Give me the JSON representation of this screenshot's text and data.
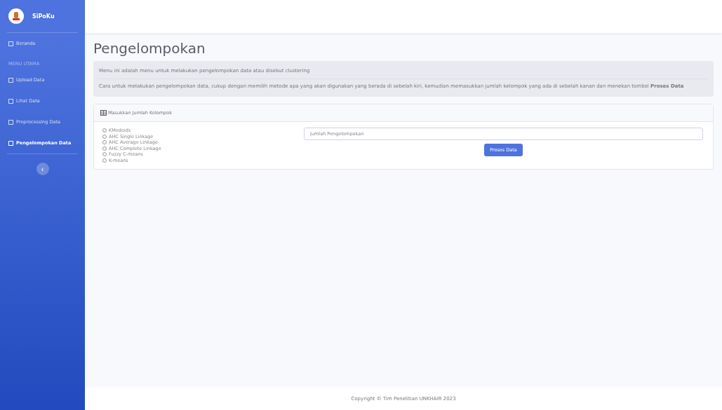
{
  "brand": {
    "name": "SiPoKu"
  },
  "sidebar": {
    "items": [
      {
        "label": "Beranda",
        "kind": "link",
        "selected": false
      },
      {
        "label": "MENU UTAMA",
        "kind": "heading"
      },
      {
        "label": "Upload Data",
        "kind": "link",
        "selected": false
      },
      {
        "label": "Lihat Data",
        "kind": "link",
        "selected": false
      },
      {
        "label": "Preprocessing Data",
        "kind": "link",
        "selected": false
      },
      {
        "label": "Pengelompokan Data",
        "kind": "link",
        "selected": true
      }
    ],
    "toggle": "‹"
  },
  "page": {
    "title": "Pengelompokan",
    "info": [
      "Menu ini adalah menu untuk melakukan pengelompokan data atau disebut clustering",
      "Cara untuk melakukan pengelompokan data, cukup dengan memilih metode apa yang akan digunakan yang berada di sebelah kiri, kemudian memasukkan jumlah kelompok yang ada di sebelah kanan dan menekan tombol **Proses Data**"
    ]
  },
  "card": {
    "header": "Masukkan Jumlah Kelompok",
    "methods": [
      {
        "label": "KMedoids",
        "selected": false
      },
      {
        "label": "AHC Single Linkage",
        "selected": false
      },
      {
        "label": "AHC Average Linkage",
        "selected": false
      },
      {
        "label": "AHC Complete Linkage",
        "selected": false
      },
      {
        "label": "Fuzzy C-means",
        "selected": false
      },
      {
        "label": "K-means",
        "selected": false
      }
    ],
    "input": {
      "placeholder": "Jumlah Pengelompokan"
    },
    "button": "Proses Data"
  },
  "footer": "Copyright © Tim Penelitian UNKHAIR 2023"
}
